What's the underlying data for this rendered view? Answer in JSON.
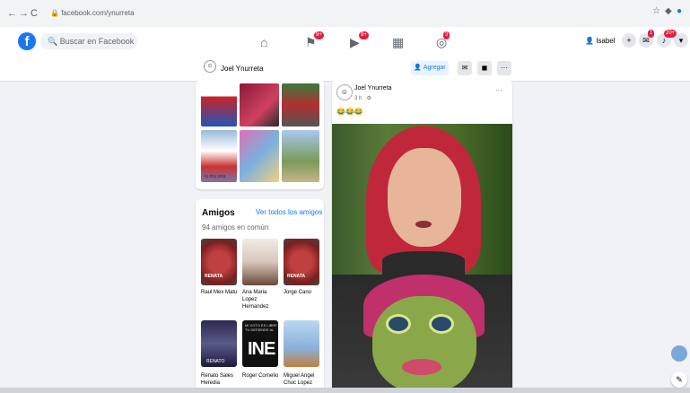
{
  "browser": {
    "url": "facebook.com/ynurreta",
    "nav": [
      "←",
      "→",
      "C"
    ]
  },
  "header": {
    "search_placeholder": "Buscar en Facebook",
    "user": "Isabel",
    "badges": {
      "pages": "9+",
      "watch": "9+",
      "groups": "3",
      "notifications": "20+",
      "messenger": "1"
    }
  },
  "profile_bar": {
    "name": "Joel Ynurreta",
    "add_button": "Agregar"
  },
  "photos": {
    "caption": "la doy orta"
  },
  "friends": {
    "title": "Amigos",
    "see_all": "Ver todos los amigos",
    "mutual": "94 amigos en común",
    "list": [
      {
        "name": "Raul Mex Matu"
      },
      {
        "name": "Ana Maria Lopez Hernandez"
      },
      {
        "name": "Jorge Cano"
      },
      {
        "name": "Renato Sales Heredia"
      },
      {
        "name": "Roger Cornelio"
      },
      {
        "name": "Miguel Angel Chuc Lopez"
      }
    ],
    "renata_label": "RENATA",
    "ine_label": "INE",
    "ine_caption": "MI VOTO ES LIBRE TU DEFIENDE AL",
    "renato_label": "RENATO"
  },
  "post": {
    "author": "Joel Ynurreta",
    "time": "3 h · ⚙",
    "emojis": "😂😂😂",
    "menu": "···"
  },
  "colors": {
    "brand": "#1877f2",
    "badge": "#e41e3f"
  }
}
